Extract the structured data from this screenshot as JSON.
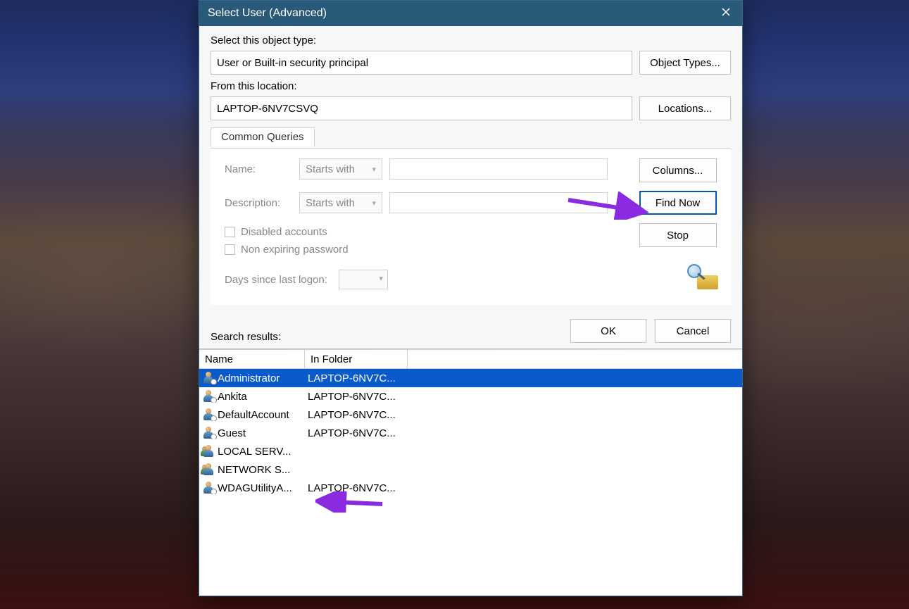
{
  "window": {
    "title": "Select User (Advanced)"
  },
  "objectType": {
    "label": "Select this object type:",
    "value": "User or Built-in security principal",
    "button": "Object Types..."
  },
  "location": {
    "label": "From this location:",
    "value": "LAPTOP-6NV7CSVQ",
    "button": "Locations..."
  },
  "tab": {
    "label": "Common Queries"
  },
  "queries": {
    "name_label": "Name:",
    "name_mode": "Starts with",
    "desc_label": "Description:",
    "desc_mode": "Starts with",
    "chk_disabled": "Disabled accounts",
    "chk_nonexpiring": "Non expiring password",
    "days_label": "Days since last logon:"
  },
  "sideButtons": {
    "columns": "Columns...",
    "findNow": "Find Now",
    "stop": "Stop"
  },
  "actions": {
    "searchResultsLabel": "Search results:",
    "ok": "OK",
    "cancel": "Cancel"
  },
  "columns": {
    "name": "Name",
    "folder": "In Folder"
  },
  "results": [
    {
      "name": "Administrator",
      "folder": "LAPTOP-6NV7C...",
      "icon": "user",
      "selected": true
    },
    {
      "name": "Ankita",
      "folder": "LAPTOP-6NV7C...",
      "icon": "user",
      "selected": false
    },
    {
      "name": "DefaultAccount",
      "folder": "LAPTOP-6NV7C...",
      "icon": "user",
      "selected": false
    },
    {
      "name": "Guest",
      "folder": "LAPTOP-6NV7C...",
      "icon": "user",
      "selected": false
    },
    {
      "name": "LOCAL SERV...",
      "folder": "",
      "icon": "group",
      "selected": false
    },
    {
      "name": "NETWORK S...",
      "folder": "",
      "icon": "group",
      "selected": false
    },
    {
      "name": "WDAGUtilityA...",
      "folder": "LAPTOP-6NV7C...",
      "icon": "user",
      "selected": false
    }
  ]
}
